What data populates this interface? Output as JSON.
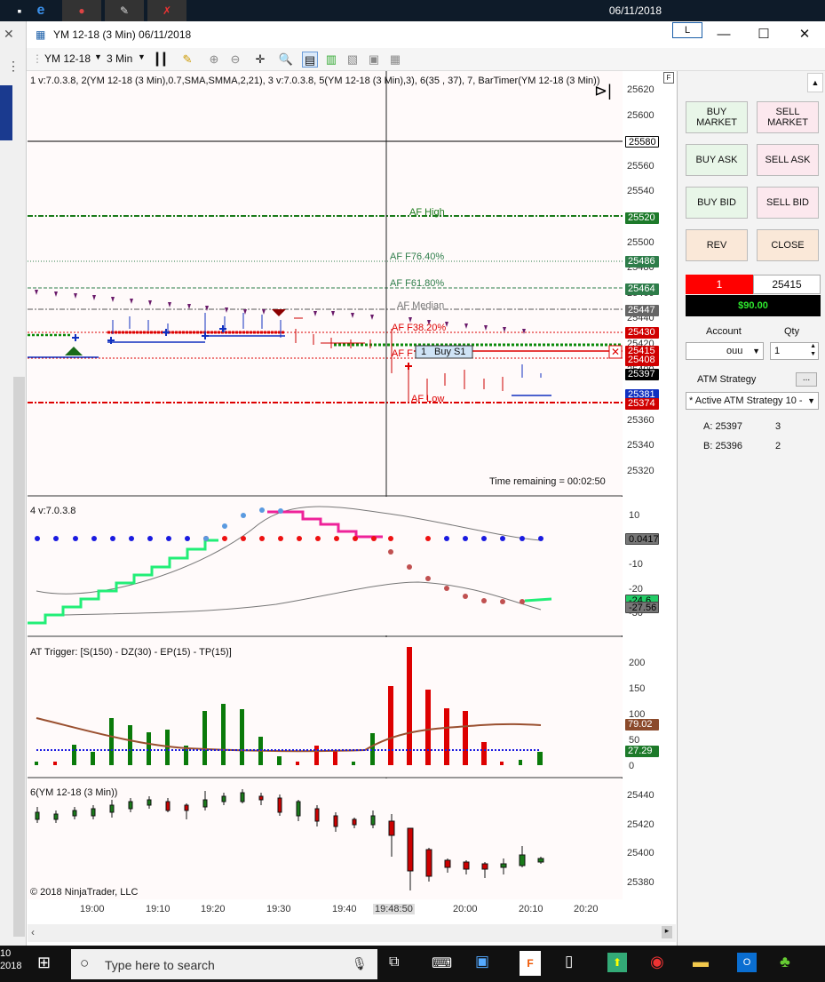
{
  "taskbar_top": {
    "date": "06/11/2018"
  },
  "window": {
    "title": "YM 12-18 (3 Min)  06/11/2018",
    "minimize": "—",
    "maximize": "☐",
    "close": "✕",
    "badge": "L"
  },
  "toolbar": {
    "instrument": "YM 12-18",
    "interval": "3 Min"
  },
  "chart": {
    "top_pane_label": "1 v:7.0.3.8, 2(YM 12-18 (3 Min),0.7,SMA,SMMA,2,21), 3 v:7.0.3.8, 5(YM 12-18 (3 Min),3), 6(35 , 37), 7, BarTimer(YM 12-18 (3 Min))",
    "pane2_label": "4 v:7.0.3.8",
    "pane3_label": "AT Trigger: [S(150) - DZ(30) - EP(15) - TP(15)]",
    "pane4_label": "6(YM 12-18 (3 Min))",
    "copyright": "© 2018 NinjaTrader, LLC",
    "time_remaining": "Time remaining = 00:02:50",
    "fib_labels": {
      "high": "AF High",
      "f76": "AF F76.40%",
      "f61": "AF F61.80%",
      "median": "AF Median",
      "f38": "AF F38.20%",
      "f23": "AF F",
      "low": "AF Low"
    },
    "position_label": "1",
    "position_name": "Buy S1",
    "price_ticks": [
      "25620",
      "25600",
      "25580",
      "25560",
      "25540",
      "25520",
      "25500",
      "25480",
      "25460",
      "25440",
      "25420",
      "25400",
      "25380",
      "25360",
      "25340",
      "25320"
    ],
    "price_tags": [
      {
        "value": "25580",
        "color": "#ffffff",
        "text_color": "#000"
      },
      {
        "value": "25520",
        "color": "#1d7a2a",
        "text_color": "#fff"
      },
      {
        "value": "25486",
        "color": "#2e7d4a",
        "text_color": "#fff"
      },
      {
        "value": "25464",
        "color": "#2e7d4a",
        "text_color": "#fff"
      },
      {
        "value": "25447",
        "color": "#666666",
        "text_color": "#fff"
      },
      {
        "value": "25430",
        "color": "#d00000",
        "text_color": "#fff"
      },
      {
        "value": "25415",
        "color": "#d00000",
        "text_color": "#fff"
      },
      {
        "value": "25408",
        "color": "#d00000",
        "text_color": "#fff"
      },
      {
        "value": "25397",
        "color": "#000000",
        "text_color": "#fff"
      },
      {
        "value": "25381",
        "color": "#1030c0",
        "text_color": "#fff"
      },
      {
        "value": "25374",
        "color": "#d00000",
        "text_color": "#fff"
      }
    ],
    "osc_ticks": [
      "10",
      "0",
      "-10",
      "-20",
      "-30"
    ],
    "osc_tags": [
      {
        "value": "0.0417",
        "color": "#777777"
      },
      {
        "value": "-24.6",
        "color": "#22cc66"
      },
      {
        "value": "-27.56",
        "color": "#777777"
      }
    ],
    "trig_ticks": [
      "200",
      "150",
      "100",
      "50",
      "0"
    ],
    "trig_tags": [
      {
        "value": "79.02",
        "color": "#8b4a2b"
      },
      {
        "value": "27.29",
        "color": "#1d7a2a"
      }
    ],
    "candle_ticks": [
      "25440",
      "25420",
      "25400",
      "25380"
    ],
    "time_labels": [
      "19:00",
      "19:10",
      "19:20",
      "19:30",
      "19:40",
      "19:48:50",
      "20:00",
      "20:10",
      "20:20"
    ]
  },
  "order_panel": {
    "buy_market": "BUY MARKET",
    "sell_market": "SELL MARKET",
    "buy_ask": "BUY ASK",
    "sell_ask": "SELL ASK",
    "buy_bid": "BUY BID",
    "sell_bid": "SELL BID",
    "rev": "REV",
    "close": "CLOSE",
    "position_qty": "1",
    "position_price": "25415",
    "pnl": "$90.00",
    "account_label": "Account",
    "qty_label": "Qty",
    "account_value": "ouu",
    "qty_value": "1",
    "atm_label": "ATM Strategy",
    "atm_more": "...",
    "atm_value": "* Active ATM Strategy 10 -",
    "ask_label": "A: 25397",
    "ask_size": "3",
    "bid_label": "B: 25396",
    "bid_size": "2"
  },
  "taskbar": {
    "search_placeholder": "Type here to search",
    "clock_time": "10",
    "clock_year": "2018"
  }
}
